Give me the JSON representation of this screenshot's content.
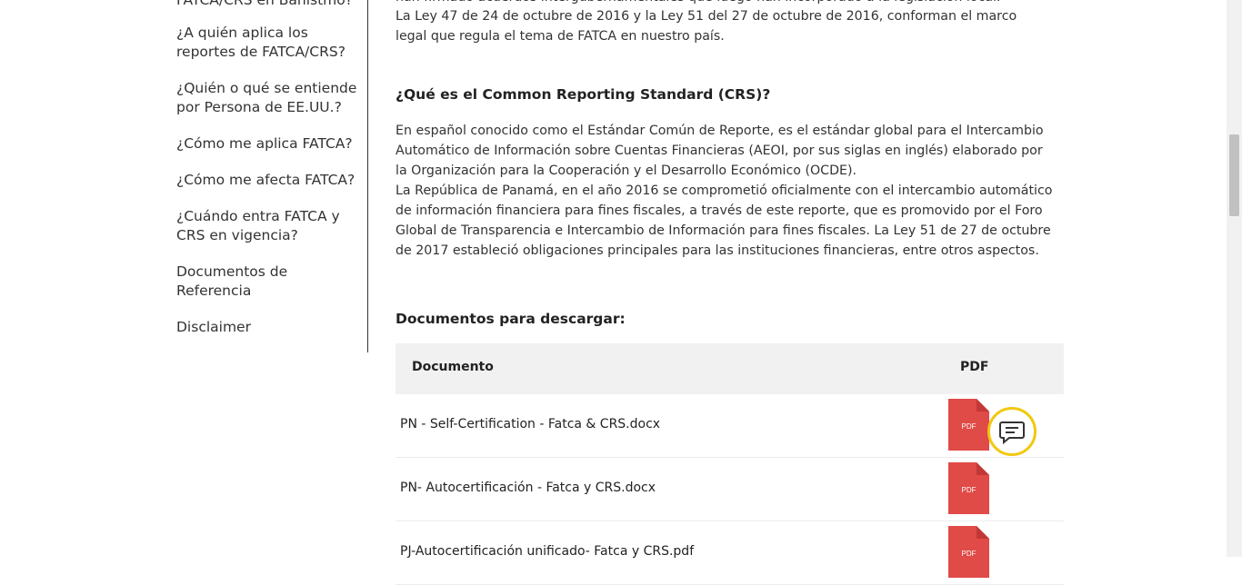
{
  "sidebar": {
    "items": [
      {
        "label": "FATCA/CRS en Banistmo?"
      },
      {
        "label": "¿A quién aplica los reportes de FATCA/CRS?"
      },
      {
        "label": "¿Quién o qué se entiende por Persona de EE.UU.?"
      },
      {
        "label": "¿Cómo me aplica FATCA?"
      },
      {
        "label": "¿Cómo me afecta FATCA?"
      },
      {
        "label": "¿Cuándo entra FATCA y CRS en vigencia?"
      },
      {
        "label": "Documentos de Referencia"
      },
      {
        "label": "Disclaimer"
      }
    ]
  },
  "content": {
    "cut_line": "han firmado acuerdos intergubernamentales que luego han incorporado a la legislación local.",
    "intro": "La Ley 47 de 24 de octubre de 2016 y la Ley 51 del 27 de octubre de 2016, conforman el marco legal que regula el tema de FATCA en nuestro país.",
    "crs_title": "¿Qué es el Common Reporting Standard (CRS)?",
    "crs_p1": "En español conocido como el Estándar Común de Reporte, es el estándar global para el Intercambio Automático de Información sobre Cuentas Financieras (AEOI, por sus siglas en inglés) elaborado por la Organización para la Cooperación y el Desarrollo Económico (OCDE).",
    "crs_p2": "La República de Panamá, en el año 2016 se comprometió oficialmente con el intercambio automático de información financiera para fines fiscales, a través de este reporte,  que es promovido por el Foro Global de Transparencia e Intercambio de Información para fines fiscales.  La Ley 51 de 27 de octubre de 2017 estableció obligaciones principales para las instituciones financieras, entre otros aspectos.",
    "downloads_title": "Documentos para descargar:"
  },
  "table": {
    "col_doc": "Documento",
    "col_pdf": "PDF",
    "pdf_icon_label": "PDF",
    "rows": [
      {
        "name": "PN - Self-Certification - Fatca & CRS.docx"
      },
      {
        "name": "PN- Autocertificación - Fatca y CRS.docx"
      },
      {
        "name": "PJ-Autocertificación unificado- Fatca y CRS.pdf"
      }
    ]
  },
  "colors": {
    "pdf_red": "#e04a47",
    "chat_ring": "#f2c811"
  },
  "icons": {
    "pdf": "pdf-file-icon",
    "chat": "chat-bubble-icon"
  }
}
